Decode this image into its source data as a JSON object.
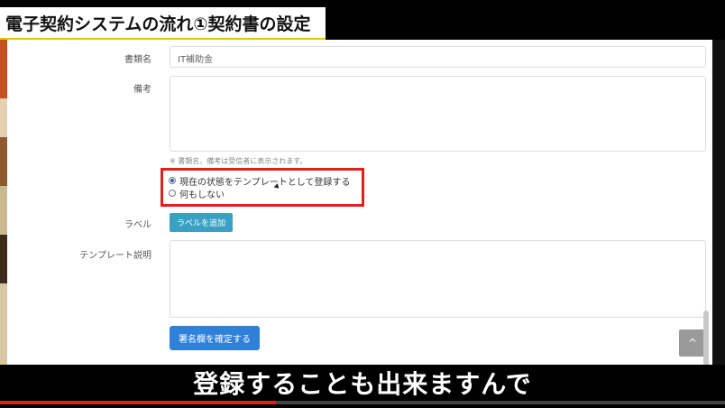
{
  "banner": {
    "title": "電子契約システムの流れ①契約書の設定"
  },
  "form": {
    "doc_name_label": "書類名",
    "doc_name_value": "IT補助金",
    "remarks_label": "備考",
    "note": "※ 書類名、備考は受信者に表示されます。",
    "radio_options": [
      {
        "label": "現在の状態をテンプレートとして登録する",
        "checked": true
      },
      {
        "label": "何もしない",
        "checked": false
      }
    ],
    "label_label": "ラベル",
    "add_label_button": "ラベルを追加",
    "template_desc_label": "テンプレート説明",
    "confirm_signature_button": "署名欄を確定する",
    "back_to_top_icon": "^"
  },
  "subtitle": "登録することも出来ますんで",
  "video": {
    "progress": 0.38
  },
  "colors": {
    "highlight_box": "#e0201c",
    "primary": "#2e80d8",
    "info": "#3aa0c4"
  }
}
